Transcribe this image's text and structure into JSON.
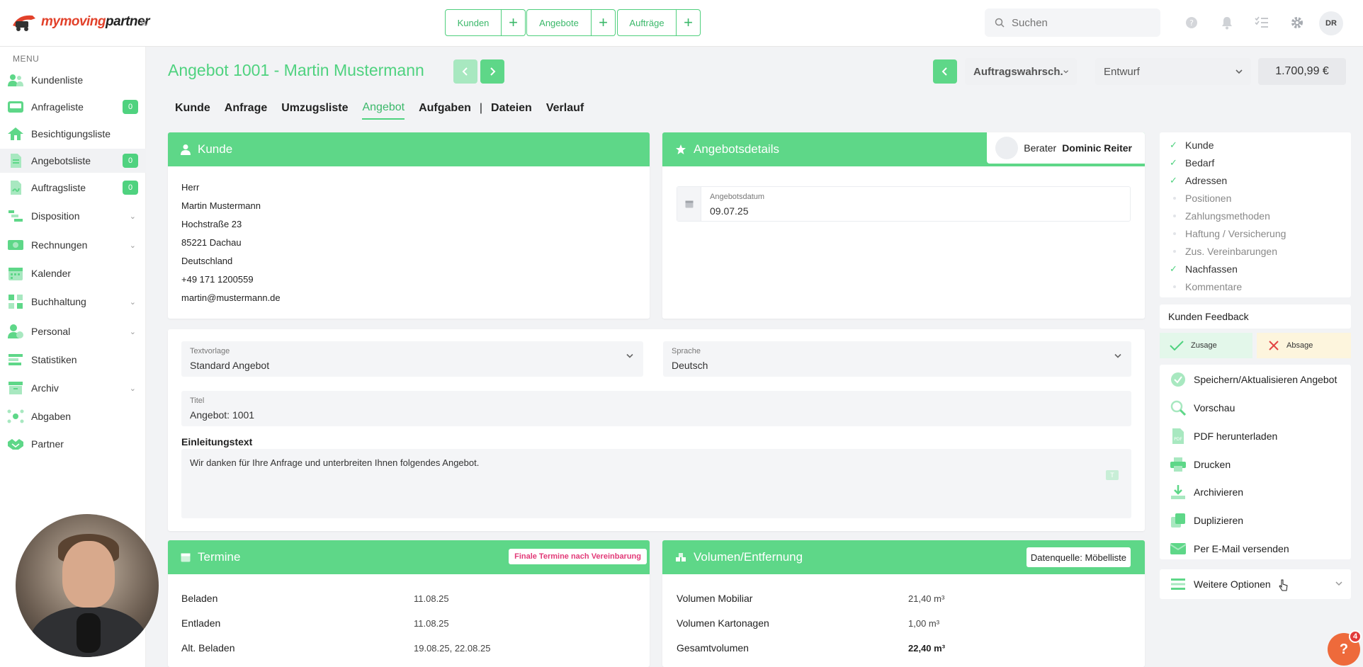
{
  "logo": {
    "text_a": "mymoving",
    "text_b": "partner"
  },
  "quick_actions": [
    {
      "label": "Kunden"
    },
    {
      "label": "Angebote"
    },
    {
      "label": "Aufträge"
    }
  ],
  "plus_label": "+",
  "search": {
    "placeholder": "Suchen"
  },
  "user_initials": "DR",
  "sidebar": {
    "menu_label": "MENU",
    "items": [
      {
        "label": "Kundenliste"
      },
      {
        "label": "Anfrageliste",
        "badge": "0"
      },
      {
        "label": "Besichtigungsliste"
      },
      {
        "label": "Angebotsliste",
        "badge": "0"
      },
      {
        "label": "Auftragsliste",
        "badge": "0"
      },
      {
        "label": "Disposition"
      },
      {
        "label": "Rechnungen"
      },
      {
        "label": "Kalender"
      },
      {
        "label": "Buchhaltung"
      },
      {
        "label": "Personal"
      },
      {
        "label": "Statistiken"
      },
      {
        "label": "Archiv"
      },
      {
        "label": "Abgaben"
      },
      {
        "label": "Partner"
      }
    ]
  },
  "page": {
    "title": "Angebot 1001 - Martin Mustermann",
    "probability": "Auftragswahrsch.",
    "status": "Entwurf",
    "price": "1.700,99 €"
  },
  "tabs": [
    "Kunde",
    "Anfrage",
    "Umzugsliste",
    "Angebot",
    "Aufgaben",
    "|",
    "Dateien",
    "Verlauf"
  ],
  "kunde": {
    "heading": "Kunde",
    "lines": [
      "Herr",
      "Martin Mustermann",
      "Hochstraße 23",
      "85221 Dachau",
      "Deutschland",
      "+49 171 1200559",
      "martin@mustermann.de"
    ]
  },
  "details": {
    "heading": "Angebotsdetails",
    "berater_label": "Berater",
    "berater_name": "Dominic Reiter",
    "date_label": "Angebotsdatum",
    "date_value": "09.07.25"
  },
  "text": {
    "template_label": "Textvorlage",
    "template_value": "Standard Angebot",
    "lang_label": "Sprache",
    "lang_value": "Deutsch",
    "title_label": "Titel",
    "title_value": "Angebot: 1001",
    "intro_label": "Einleitungstext",
    "intro_value": "Wir danken für Ihre Anfrage und unterbreiten Ihnen folgendes Angebot."
  },
  "termine": {
    "heading": "Termine",
    "tag": "Finale Termine nach Vereinbarung",
    "rows": [
      {
        "label": "Beladen",
        "value": "11.08.25"
      },
      {
        "label": "Entladen",
        "value": "11.08.25"
      },
      {
        "label": "Alt. Beladen",
        "value": "19.08.25, 22.08.25"
      }
    ]
  },
  "volumen": {
    "heading": "Volumen/Entfernung",
    "tag": "Datenquelle: Möbelliste",
    "rows": [
      {
        "label": "Volumen Mobiliar",
        "value": "21,40 m³"
      },
      {
        "label": "Volumen Kartonagen",
        "value": "1,00 m³"
      },
      {
        "label": "Gesamtvolumen",
        "value": "22,40 m³"
      }
    ]
  },
  "checklist": [
    {
      "label": "Kunde",
      "done": true
    },
    {
      "label": "Bedarf",
      "done": true
    },
    {
      "label": "Adressen",
      "done": true
    },
    {
      "label": "Positionen",
      "done": false
    },
    {
      "label": "Zahlungsmethoden",
      "done": false
    },
    {
      "label": "Haftung / Versicherung",
      "done": false
    },
    {
      "label": "Zus. Vereinbarungen",
      "done": false
    },
    {
      "label": "Nachfassen",
      "done": true
    },
    {
      "label": "Kommentare",
      "done": false
    }
  ],
  "feedback": {
    "label": "Kunden Feedback",
    "accept": "Zusage",
    "reject": "Absage"
  },
  "actions": [
    {
      "label": "Speichern/Aktualisieren Angebot"
    },
    {
      "label": "Vorschau"
    },
    {
      "label": "PDF herunterladen"
    },
    {
      "label": "Drucken"
    },
    {
      "label": "Archivieren"
    },
    {
      "label": "Duplizieren"
    },
    {
      "label": "Per E-Mail versenden"
    }
  ],
  "more_options": "Weitere Optionen",
  "help": {
    "symbol": "?",
    "count": "4"
  },
  "colors": {
    "accent": "#5ed788",
    "brand": "#e2412a",
    "pink": "#e23a78"
  }
}
